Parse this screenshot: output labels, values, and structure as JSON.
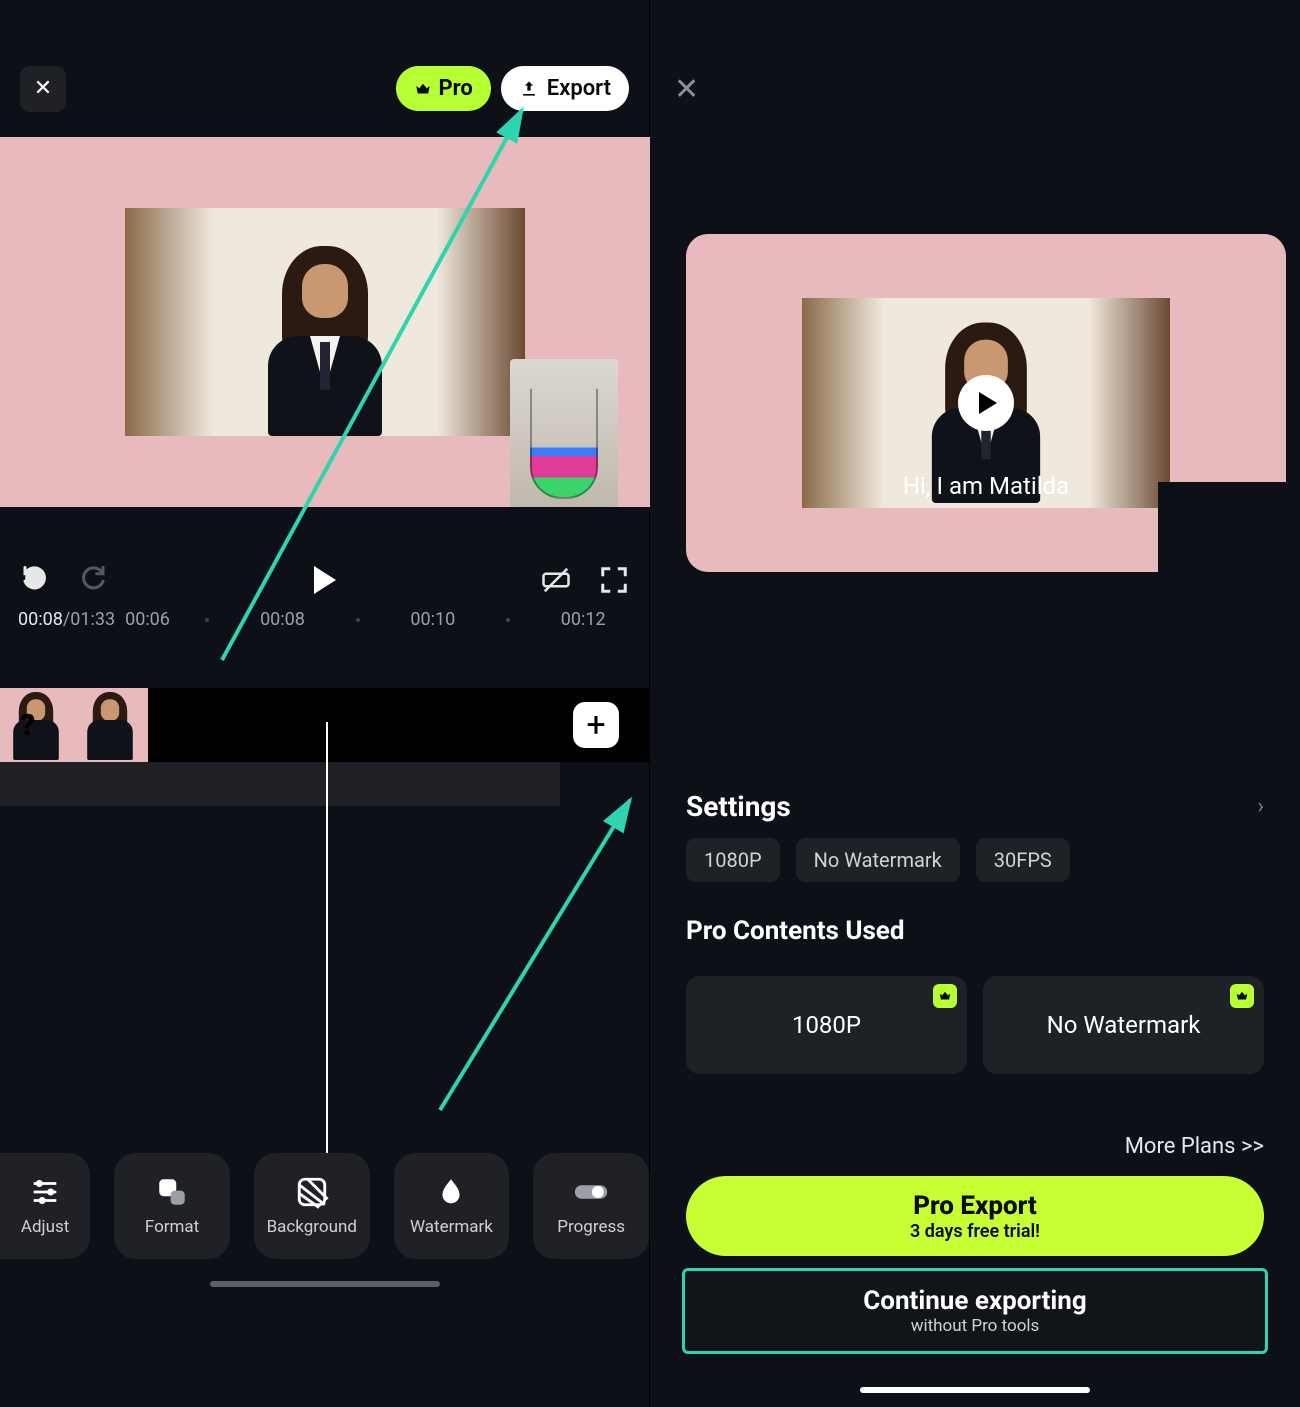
{
  "left": {
    "pro_label": "Pro",
    "export_label": "Export",
    "time_current": "00:08",
    "time_total": "01:33",
    "time_marks": [
      "00:06",
      "00:08",
      "00:10",
      "00:12"
    ],
    "tools": [
      {
        "label": "Adjust",
        "icon": "adjust-icon"
      },
      {
        "label": "Format",
        "icon": "format-icon"
      },
      {
        "label": "Background",
        "icon": "background-icon"
      },
      {
        "label": "Watermark",
        "icon": "watermark-icon"
      },
      {
        "label": "Progress",
        "icon": "progress-icon"
      }
    ]
  },
  "right": {
    "subtitle": "Hi, I am Matilda",
    "settings_title": "Settings",
    "chips": [
      "1080P",
      "No Watermark",
      "30FPS"
    ],
    "pro_contents_title": "Pro Contents Used",
    "pro_cards": [
      "1080P",
      "No Watermark"
    ],
    "more_plans": "More Plans >>",
    "pro_export_title": "Pro Export",
    "pro_export_sub": "3 days free trial!",
    "continue_title": "Continue exporting",
    "continue_sub": "without Pro tools"
  }
}
